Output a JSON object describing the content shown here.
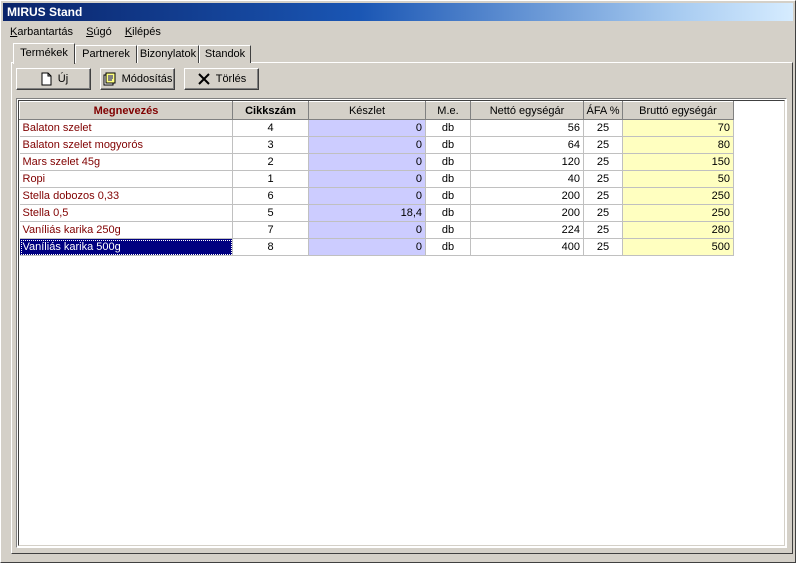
{
  "window": {
    "title": "MIRUS Stand"
  },
  "menu": [
    {
      "label_u": "K",
      "label_rest": "arbantartás"
    },
    {
      "label_u": "S",
      "label_rest": "úgó"
    },
    {
      "label_u": "K",
      "label_rest": "ilépés",
      "pre": ""
    }
  ],
  "tabs": [
    {
      "label": "Termékek",
      "active": true
    },
    {
      "label": "Partnerek",
      "active": false
    },
    {
      "label": "Bizonylatok",
      "active": false
    },
    {
      "label": "Standok",
      "active": false
    }
  ],
  "toolbar": {
    "new_label": "Új",
    "edit_label": "Módosítás",
    "delete_label": "Törlés"
  },
  "table": {
    "headers": [
      "Megnevezés",
      "Cikkszám",
      "Készlet",
      "M.e.",
      "Nettó egységár",
      "ÁFA %",
      "Bruttó egységár"
    ],
    "rows": [
      [
        "Balaton szelet",
        "4",
        "0",
        "db",
        "56",
        "25",
        "70"
      ],
      [
        "Balaton szelet mogyorós",
        "3",
        "0",
        "db",
        "64",
        "25",
        "80"
      ],
      [
        "Mars szelet 45g",
        "2",
        "0",
        "db",
        "120",
        "25",
        "150"
      ],
      [
        "Ropi",
        "1",
        "0",
        "db",
        "40",
        "25",
        "50"
      ],
      [
        "Stella dobozos 0,33",
        "6",
        "0",
        "db",
        "200",
        "25",
        "250"
      ],
      [
        "Stella 0,5",
        "5",
        "18,4",
        "db",
        "200",
        "25",
        "250"
      ],
      [
        "Vaníliás karika 250g",
        "7",
        "0",
        "db",
        "224",
        "25",
        "280"
      ],
      [
        "Vaníliás karika 500g",
        "8",
        "0",
        "db",
        "400",
        "25",
        "500"
      ]
    ],
    "selected_row": 7
  },
  "colors": {
    "name_text": "#800000",
    "stock_bg": "#ccccff",
    "gross_bg": "#ffffc0",
    "selection": "#000080"
  }
}
